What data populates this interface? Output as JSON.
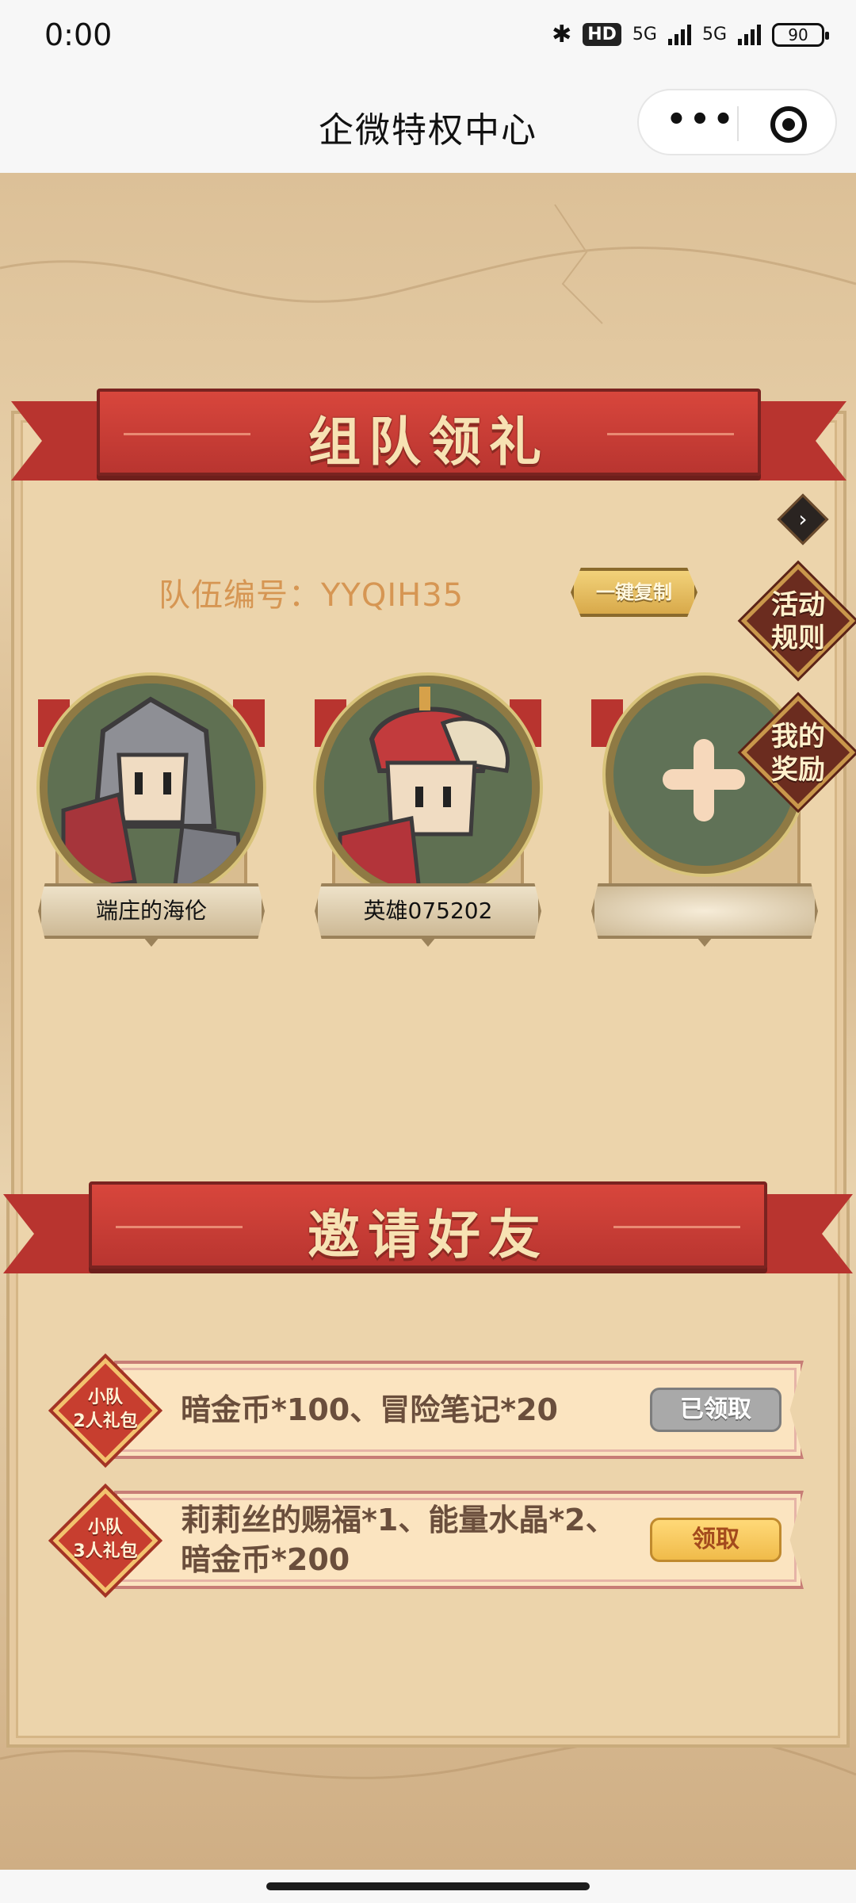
{
  "status_bar": {
    "time": "0:00",
    "bluetooth_icon": "bluetooth-icon",
    "hd_label": "HD",
    "network_1": "5G",
    "network_2": "5G",
    "battery": "90"
  },
  "nav": {
    "title": "企微特权中心",
    "more_icon": "more-dots-icon",
    "close_icon": "target-icon"
  },
  "team_section": {
    "banner": "组队领礼",
    "team_id_text": "队伍编号：YYQIH35",
    "copy_button": "一键复制",
    "rules_button": "活动\n规则",
    "rewards_button": "我的\n奖励",
    "members": [
      {
        "name": "端庄的海伦",
        "avatar": "knight-avatar"
      },
      {
        "name": "英雄075202",
        "avatar": "hero-avatar"
      },
      {
        "name": "",
        "avatar": "add-member-icon"
      }
    ]
  },
  "invite_section": {
    "banner": "邀请好友",
    "gifts": [
      {
        "badge": "小队\n2人礼包",
        "desc": "暗金币*100、冒险笔记*20",
        "button": "已领取",
        "state": "claimed"
      },
      {
        "badge": "小队\n3人礼包",
        "desc": "莉莉丝的赐福*1、能量水晶*2、\n暗金币*200",
        "button": "领取",
        "state": "available"
      }
    ]
  },
  "colors": {
    "ribbon_red": "#b8342f",
    "banner_text": "#f7e2b3",
    "panel_bg": "#ecd4ab",
    "team_id_text": "#d69653"
  }
}
